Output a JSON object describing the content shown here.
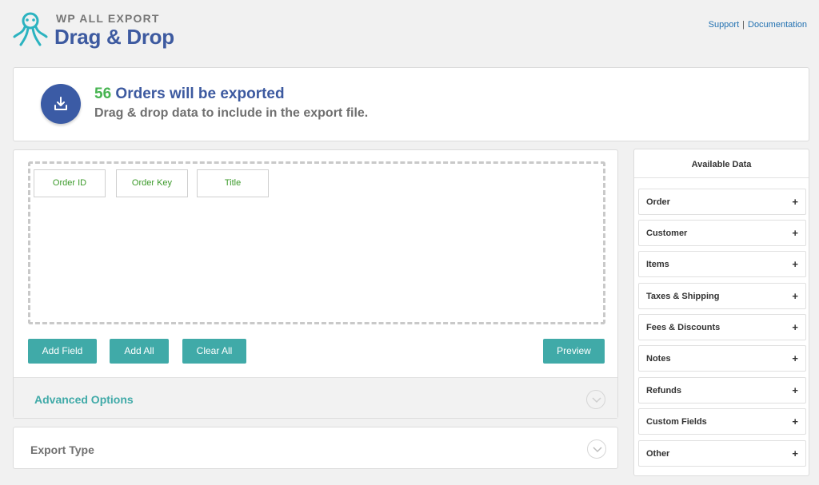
{
  "header": {
    "brand_small": "WP ALL EXPORT",
    "brand_big": "Drag & Drop",
    "links": {
      "support": "Support",
      "separator": "|",
      "documentation": "Documentation"
    }
  },
  "banner": {
    "count": "56",
    "title_rest": "Orders will be exported",
    "subtitle": "Drag & drop data to include in the export file."
  },
  "fields": [
    {
      "label": "Order ID"
    },
    {
      "label": "Order Key"
    },
    {
      "label": "Title"
    }
  ],
  "buttons": {
    "add_field": "Add Field",
    "add_all": "Add All",
    "clear_all": "Clear All",
    "preview": "Preview"
  },
  "advanced_options": {
    "label": "Advanced Options"
  },
  "export_type": {
    "label": "Export Type"
  },
  "sidebar": {
    "title": "Available Data",
    "items": [
      {
        "label": "Order"
      },
      {
        "label": "Customer"
      },
      {
        "label": "Items"
      },
      {
        "label": "Taxes & Shipping"
      },
      {
        "label": "Fees & Discounts"
      },
      {
        "label": "Notes"
      },
      {
        "label": "Refunds"
      },
      {
        "label": "Custom Fields"
      },
      {
        "label": "Other"
      }
    ],
    "plus_glyph": "+"
  },
  "colors": {
    "brand_blue": "#3d5aa0",
    "teal": "#40aaa8",
    "count_green": "#46b450",
    "field_green": "#3b9a2a"
  }
}
